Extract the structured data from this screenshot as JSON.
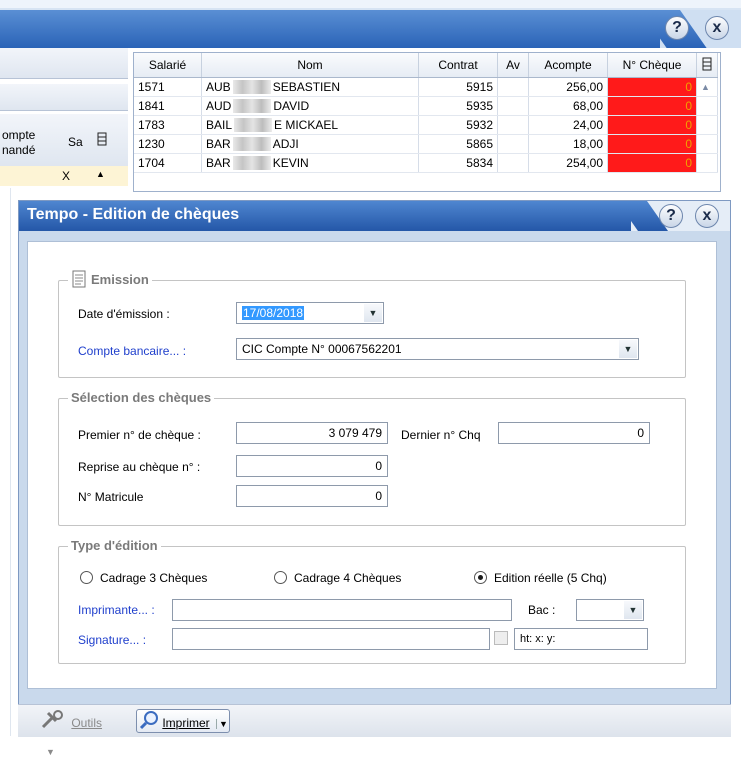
{
  "window": {
    "help_label": "?",
    "close_label": "x"
  },
  "left_panel": {
    "header_line1": "ompte",
    "header_line2": "nandé",
    "col_sa": "Sa",
    "col_icon": "grid-settings-icon",
    "row_value": "X",
    "scroll_up": "▲"
  },
  "grid": {
    "columns": [
      "Salarié",
      "Nom",
      "Contrat",
      "Av",
      "Acompte",
      "N° Chèque"
    ],
    "rows": [
      {
        "salarie": "1571",
        "nom_prefix": "AUB",
        "nom_suffix": "SEBASTIEN",
        "contrat": "5915",
        "av": "",
        "acompte": "256,00",
        "cheque": "0"
      },
      {
        "salarie": "1841",
        "nom_prefix": "AUD",
        "nom_suffix": "DAVID",
        "contrat": "5935",
        "av": "",
        "acompte": "68,00",
        "cheque": "0"
      },
      {
        "salarie": "1783",
        "nom_prefix": "BAIL",
        "nom_suffix": "E  MICKAEL",
        "contrat": "5932",
        "av": "",
        "acompte": "24,00",
        "cheque": "0"
      },
      {
        "salarie": "1230",
        "nom_prefix": "BAR",
        "nom_suffix": "ADJI",
        "contrat": "5865",
        "av": "",
        "acompte": "18,00",
        "cheque": "0"
      },
      {
        "salarie": "1704",
        "nom_prefix": "BAR",
        "nom_suffix": "KEVIN",
        "contrat": "5834",
        "av": "",
        "acompte": "254,00",
        "cheque": "0"
      }
    ],
    "highlight_color": "#ff1a1a"
  },
  "dialog": {
    "title": "Tempo - Edition de chèques",
    "help_label": "?",
    "close_label": "x",
    "emission": {
      "legend": "Emission",
      "date_label": "Date d'émission :",
      "date_value": "17/08/2018",
      "compte_label": "Compte bancaire... :",
      "compte_value": "CIC  Compte N° 00067562201"
    },
    "selection": {
      "legend": "Sélection des chèques",
      "premier_label": "Premier n° de chèque :",
      "premier_value": "3 079 479",
      "dernier_label": "Dernier n° Chq",
      "dernier_value": "0",
      "reprise_label": "Reprise au chèque n° :",
      "reprise_value": "0",
      "matricule_label": "N° Matricule",
      "matricule_value": "0"
    },
    "edition": {
      "legend": "Type d'édition",
      "radio1": "Cadrage 3 Chèques",
      "radio2": "Cadrage 4 Chèques",
      "radio3": "Edition réelle (5 Chq)",
      "imprimante_label": "Imprimante... :",
      "imprimante_value": "",
      "bac_label": "Bac :",
      "bac_value": "",
      "signature_label": "Signature... :",
      "signature_value": "",
      "coords_value": "ht: x: y:"
    }
  },
  "toolbar": {
    "outils_label": "Outils",
    "imprimer_label": "Imprimer"
  }
}
